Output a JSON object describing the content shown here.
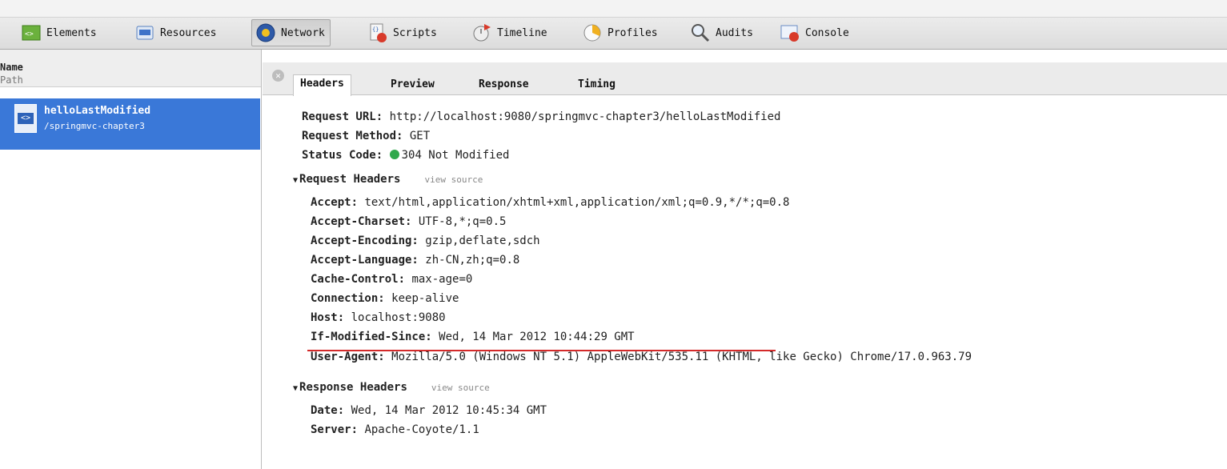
{
  "toolbar": {
    "tabs": [
      {
        "label": "Elements",
        "icon": "elements-icon"
      },
      {
        "label": "Resources",
        "icon": "resources-icon"
      },
      {
        "label": "Network",
        "icon": "network-icon"
      },
      {
        "label": "Scripts",
        "icon": "scripts-icon"
      },
      {
        "label": "Timeline",
        "icon": "timeline-icon"
      },
      {
        "label": "Profiles",
        "icon": "profiles-icon"
      },
      {
        "label": "Audits",
        "icon": "audits-icon"
      },
      {
        "label": "Console",
        "icon": "console-icon"
      }
    ],
    "active": "Network"
  },
  "sidebar": {
    "col_name": "Name",
    "col_path": "Path",
    "items": [
      {
        "name": "helloLastModified",
        "path": "/springmvc-chapter3"
      }
    ]
  },
  "detail": {
    "tabs": [
      "Headers",
      "Preview",
      "Response",
      "Timing"
    ],
    "active_tab": "Headers",
    "general": [
      {
        "key": "Request URL:",
        "value": "http://localhost:9080/springmvc-chapter3/helloLastModified"
      },
      {
        "key": "Request Method:",
        "value": "GET"
      },
      {
        "key": "Status Code:",
        "value": "304 Not Modified"
      }
    ],
    "request_headers": {
      "title": "Request Headers",
      "view_source": "view source",
      "items": [
        {
          "key": "Accept:",
          "value": "text/html,application/xhtml+xml,application/xml;q=0.9,*/*;q=0.8"
        },
        {
          "key": "Accept-Charset:",
          "value": "UTF-8,*;q=0.5"
        },
        {
          "key": "Accept-Encoding:",
          "value": "gzip,deflate,sdch"
        },
        {
          "key": "Accept-Language:",
          "value": "zh-CN,zh;q=0.8"
        },
        {
          "key": "Cache-Control:",
          "value": "max-age=0"
        },
        {
          "key": "Connection:",
          "value": "keep-alive"
        },
        {
          "key": "Host:",
          "value": "localhost:9080"
        },
        {
          "key": "If-Modified-Since:",
          "value": "Wed, 14 Mar 2012 10:44:29 GMT"
        },
        {
          "key": "User-Agent:",
          "value": "Mozilla/5.0 (Windows NT 5.1) AppleWebKit/535.11 (KHTML, like Gecko) Chrome/17.0.963.79"
        }
      ]
    },
    "response_headers": {
      "title": "Response Headers",
      "view_source": "view source",
      "items": [
        {
          "key": "Date:",
          "value": "Wed, 14 Mar 2012 10:45:34 GMT"
        },
        {
          "key": "Server:",
          "value": "Apache-Coyote/1.1"
        }
      ]
    }
  },
  "colors": {
    "selection": "#3a78d8",
    "status_ok": "#2fa84b",
    "highlight_underline": "#d42a2a"
  }
}
